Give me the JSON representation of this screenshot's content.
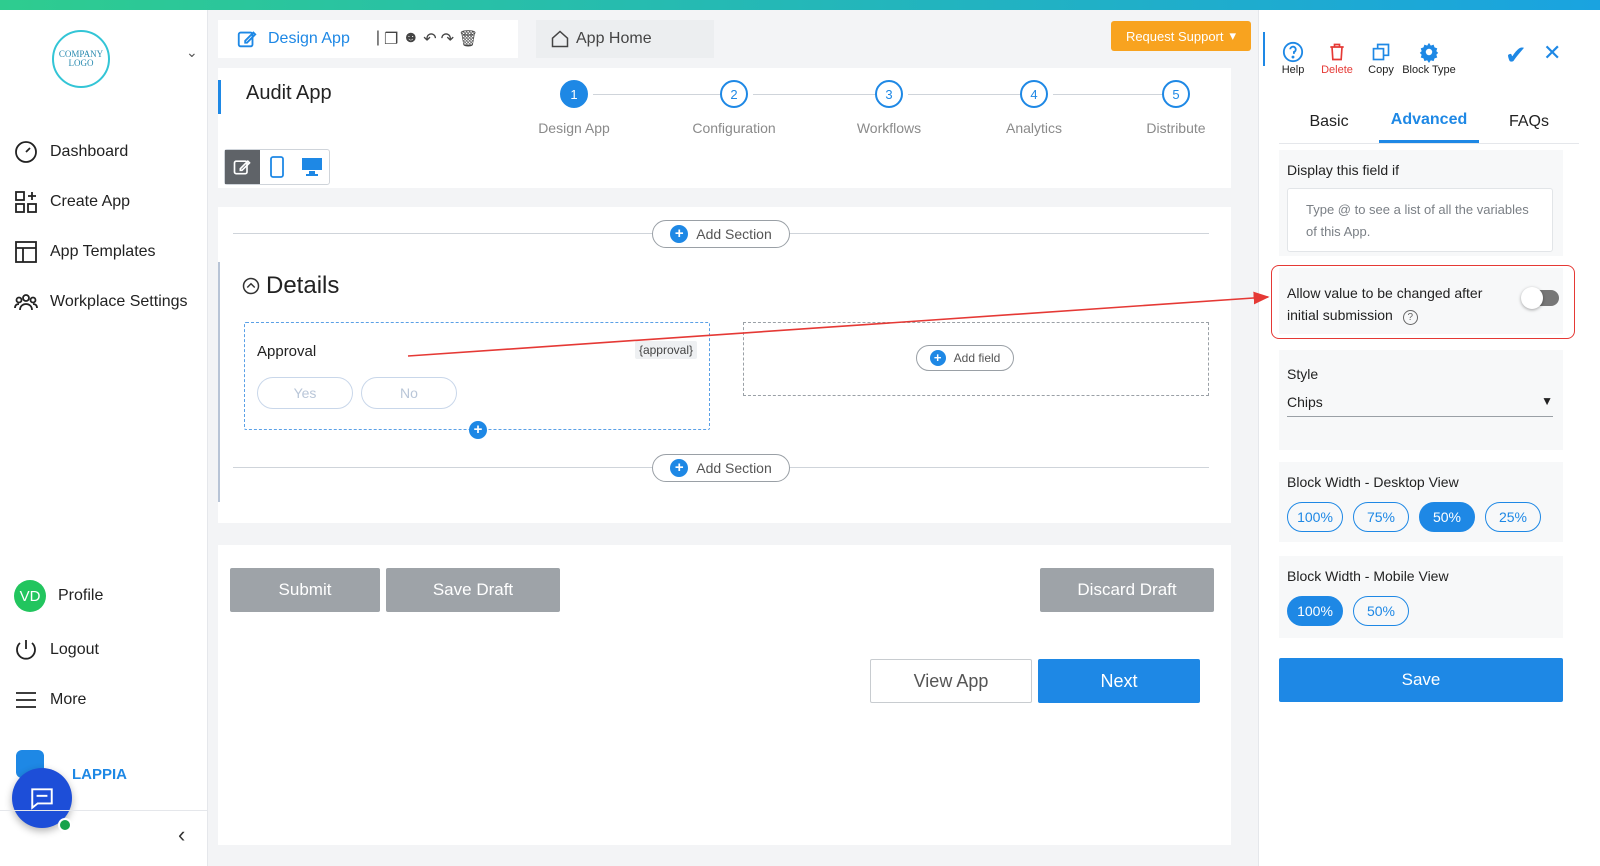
{
  "sidebar": {
    "logo_text": "COMPANY LOGO",
    "items": [
      {
        "label": "Dashboard",
        "icon": "dashboard-gauge-icon"
      },
      {
        "label": "Create App",
        "icon": "grid-plus-icon"
      },
      {
        "label": "App Templates",
        "icon": "template-icon"
      },
      {
        "label": "Workplace Settings",
        "icon": "people-icon"
      }
    ],
    "profile": {
      "initials": "VD",
      "label": "Profile"
    },
    "logout_label": "Logout",
    "more_label": "More",
    "brand_text": "LAPPIA"
  },
  "header": {
    "design_tab_label": "Design App",
    "home_tab_label": "App Home",
    "request_support_label": "Request Support",
    "app_title": "Audit App"
  },
  "steps": [
    {
      "num": "1",
      "label": "Design App",
      "active": true
    },
    {
      "num": "2",
      "label": "Configuration",
      "active": false
    },
    {
      "num": "3",
      "label": "Workflows",
      "active": false
    },
    {
      "num": "4",
      "label": "Analytics",
      "active": false
    },
    {
      "num": "5",
      "label": "Distribute",
      "active": false
    }
  ],
  "canvas": {
    "add_section_label": "Add Section",
    "section_title": "Details",
    "field": {
      "label": "Approval",
      "key": "{approval}",
      "options": [
        "Yes",
        "No"
      ]
    },
    "add_field_label": "Add field"
  },
  "actions": {
    "submit": "Submit",
    "save_draft": "Save Draft",
    "discard_draft": "Discard Draft",
    "view_app": "View App",
    "next": "Next"
  },
  "rpanel": {
    "tools": [
      {
        "label": "Help",
        "icon": "help-icon"
      },
      {
        "label": "Delete",
        "icon": "trash-icon"
      },
      {
        "label": "Copy",
        "icon": "copy-icon"
      },
      {
        "label": "Block Type",
        "icon": "gear-icon"
      }
    ],
    "tabs": [
      "Basic",
      "Advanced",
      "FAQs"
    ],
    "active_tab": "Advanced",
    "display_if_label": "Display this field if",
    "display_if_placeholder": "Type @ to see a list of all the variables of this App.",
    "allow_change_label_1": "Allow value to be changed after",
    "allow_change_label_2": "initial submission",
    "style_label": "Style",
    "style_value": "Chips",
    "desktop_width_label": "Block Width - Desktop View",
    "desktop_widths": [
      "100%",
      "75%",
      "50%",
      "25%"
    ],
    "desktop_selected": "50%",
    "mobile_width_label": "Block Width - Mobile View",
    "mobile_widths": [
      "100%",
      "50%"
    ],
    "mobile_selected": "100%",
    "save_label": "Save"
  },
  "colors": {
    "accent": "#1e88e5",
    "highlight": "#e53935",
    "support": "#f8a31f"
  }
}
